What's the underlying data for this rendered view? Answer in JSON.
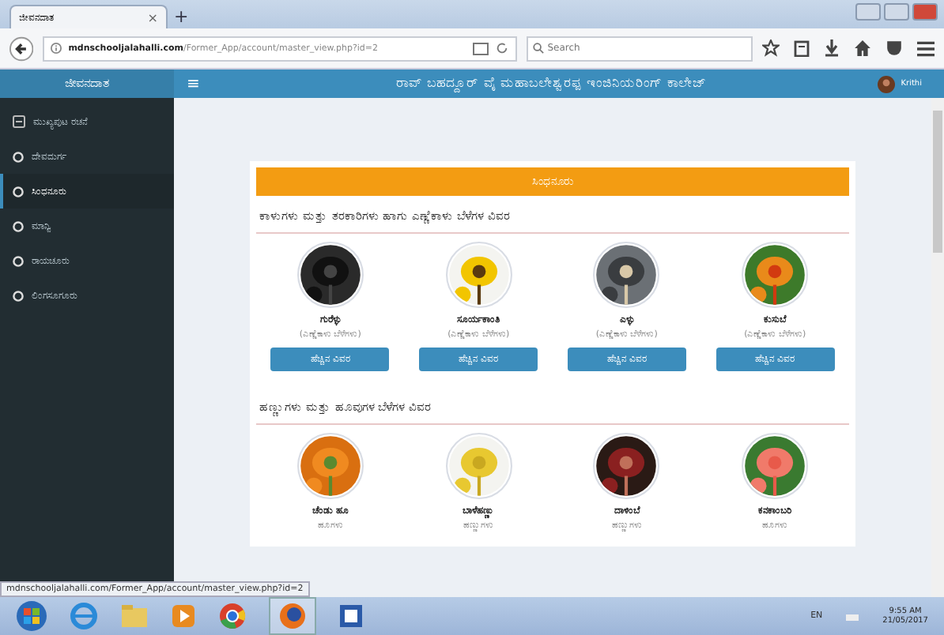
{
  "browser": {
    "tab_title": "ಜೀವನದಾತ",
    "tab_close": "×",
    "new_tab": "+",
    "url_host": "mdnschooljalahalli.com",
    "url_path": "/Former_App/account/master_view.php?id=2",
    "search_placeholder": "Search"
  },
  "app": {
    "brand": "ಜೀವನದಾತ",
    "menu_glyph": "≡",
    "college": "ರಾವ್ ಬಹದ್ದೂರ್ ವೈ ಮಹಾಬಲೇಶ್ವರಪ್ಪ ಇಂಜಿನಿಯರಿಂಗ್ ಕಾಲೇಜ್",
    "user": "Krithi"
  },
  "sidebar": {
    "items": [
      {
        "label": "ಮುಖ್ಯಪುಟ ರಚನೆ",
        "kind": "home",
        "selected": false
      },
      {
        "label": "ದೇವದುರ್ಗ",
        "kind": "place",
        "selected": false
      },
      {
        "label": "ಸಿಂಧನೂರು",
        "kind": "place",
        "selected": true
      },
      {
        "label": "ಮಾನ್ವಿ",
        "kind": "place",
        "selected": false
      },
      {
        "label": "ರಾಯಚೂರು",
        "kind": "place",
        "selected": false
      },
      {
        "label": "ಲಿಂಗಸೂಗೂರು",
        "kind": "place",
        "selected": false
      }
    ]
  },
  "banner": "ಸಿಂಧನೂರು",
  "sections": [
    {
      "title": "ಕಾಳುಗಳು ಮತ್ತು ತರಕಾರಿಗಳು ಹಾಗು ಎಣ್ಣೆಕಾಳು ಬೆಳೆಗಳ ವಿವರ",
      "crops": [
        {
          "name": "ಗುರೆಳ್ಳು",
          "category": "(ಎಣ್ಣೆಕಾಳು ಬೆಳೆಗಳು)",
          "button": "ಹೆಚ್ಚಿನ ವಿವರ"
        },
        {
          "name": "ಸೂರ್ಯಕಾಂತಿ",
          "category": "(ಎಣ್ಣೆಕಾಳು ಬೆಳೆಗಳು)",
          "button": "ಹೆಚ್ಚಿನ ವಿವರ"
        },
        {
          "name": "ಎಳ್ಳು",
          "category": "(ಎಣ್ಣೆಕಾಳು ಬೆಳೆಗಳು)",
          "button": "ಹೆಚ್ಚಿನ ವಿವರ"
        },
        {
          "name": "ಕುಸುಬೆ",
          "category": "(ಎಣ್ಣೆಕಾಳು ಬೆಳೆಗಳು)",
          "button": "ಹೆಚ್ಚಿನ ವಿವರ"
        }
      ]
    },
    {
      "title": "ಹಣ್ಣುಗಳು ಮತ್ತು ಹೂವುಗಳ ಬೆಳೆಗಳ ವಿವರ",
      "crops": [
        {
          "name": "ಚೆಂಡು ಹೂ",
          "category": "ಹೂಗಳು"
        },
        {
          "name": "ಬಾಳೆಹಣ್ಣು",
          "category": "ಹಣ್ಣುಗಳು"
        },
        {
          "name": "ದಾಳಿಂಬೆ",
          "category": "ಹಣ್ಣುಗಳು"
        },
        {
          "name": "ಕನಕಾಂಬರಿ",
          "category": "ಹೂಗಳು"
        }
      ]
    }
  ],
  "status_link": "mdnschooljalahalli.com/Former_App/account/master_view.php?id=2",
  "taskbar": {
    "lang": "EN",
    "time": "9:55 AM",
    "date": "21/05/2017"
  }
}
